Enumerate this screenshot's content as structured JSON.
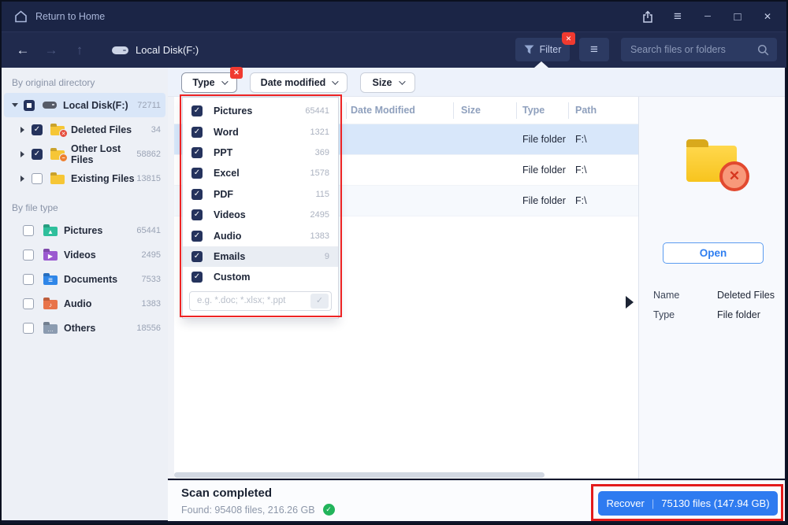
{
  "colors": {
    "titlebar": "#1b2546",
    "toolbar": "#202a4d",
    "accent_blue": "#2e7bf0",
    "selection_blue": "#d8e7fa",
    "annotation_red": "#e31b1b",
    "success_green": "#22b45b",
    "folder_yellow": "#f7c41e"
  },
  "title_bar": {
    "back_label": "Return to Home"
  },
  "toolbar": {
    "location": "Local Disk(F:)",
    "filter_label": "Filter",
    "search_placeholder": "Search files or folders"
  },
  "sidebar": {
    "section1_title": "By original directory",
    "tree": [
      {
        "label": "Local Disk(F:)",
        "count": "72711"
      },
      {
        "label": "Deleted Files",
        "count": "34"
      },
      {
        "label": "Other Lost Files",
        "count": "58862"
      },
      {
        "label": "Existing Files",
        "count": "13815"
      }
    ],
    "section2_title": "By file type",
    "types": [
      {
        "label": "Pictures",
        "count": "65441"
      },
      {
        "label": "Videos",
        "count": "2495"
      },
      {
        "label": "Documents",
        "count": "7533"
      },
      {
        "label": "Audio",
        "count": "1383"
      },
      {
        "label": "Others",
        "count": "18556"
      }
    ]
  },
  "filter_bar": {
    "type_label": "Type",
    "date_label": "Date modified",
    "size_label": "Size"
  },
  "type_dropdown": {
    "items": [
      {
        "label": "Pictures",
        "count": "65441"
      },
      {
        "label": "Word",
        "count": "1321"
      },
      {
        "label": "PPT",
        "count": "369"
      },
      {
        "label": "Excel",
        "count": "1578"
      },
      {
        "label": "PDF",
        "count": "115"
      },
      {
        "label": "Videos",
        "count": "2495"
      },
      {
        "label": "Audio",
        "count": "1383"
      },
      {
        "label": "Emails",
        "count": "9"
      },
      {
        "label": "Custom",
        "count": ""
      }
    ],
    "custom_placeholder": "e.g. *.doc; *.xlsx; *.ppt"
  },
  "table": {
    "columns": [
      "Date Modified",
      "Size",
      "Type",
      "Path"
    ],
    "rows": [
      {
        "type": "File folder",
        "path": "F:\\"
      },
      {
        "type": "File folder",
        "path": "F:\\"
      },
      {
        "type": "File folder",
        "path": "F:\\"
      }
    ]
  },
  "details": {
    "open_label": "Open",
    "fields": [
      {
        "label": "Name",
        "value": "Deleted Files"
      },
      {
        "label": "Type",
        "value": "File folder"
      }
    ]
  },
  "status": {
    "title": "Scan completed",
    "subtitle": "Found: 95408 files, 216.26 GB",
    "recover_label": "Recover",
    "recover_info": "75130 files (147.94 GB)"
  }
}
